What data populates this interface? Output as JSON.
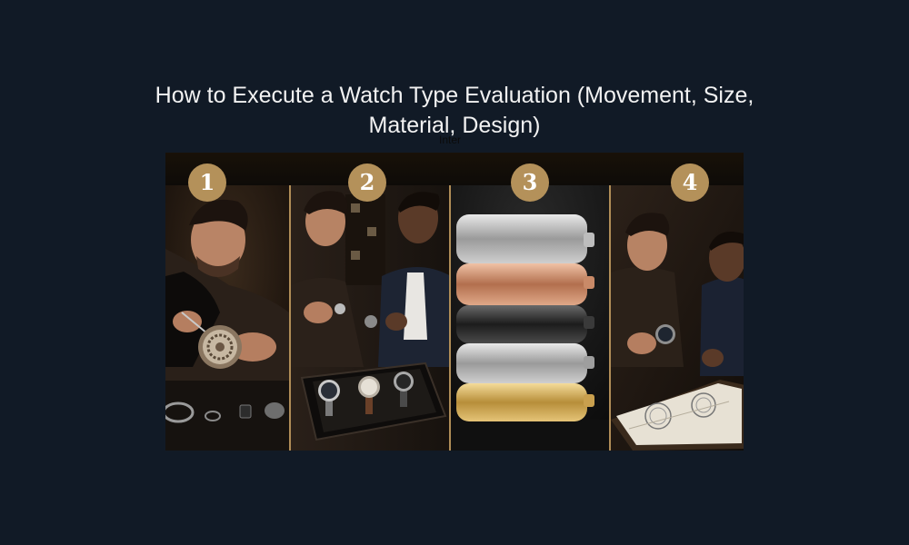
{
  "title": "How to Execute a Watch Type Evaluation (Movement, Size, Material, Design)",
  "font_tag": "Inter",
  "steps": [
    {
      "number": "1"
    },
    {
      "number": "2"
    },
    {
      "number": "3"
    },
    {
      "number": "4"
    }
  ],
  "colors": {
    "background": "#111a26",
    "badge": "#b4915a",
    "panel_border": "#b08d57",
    "title_text": "#f2f2f2"
  }
}
